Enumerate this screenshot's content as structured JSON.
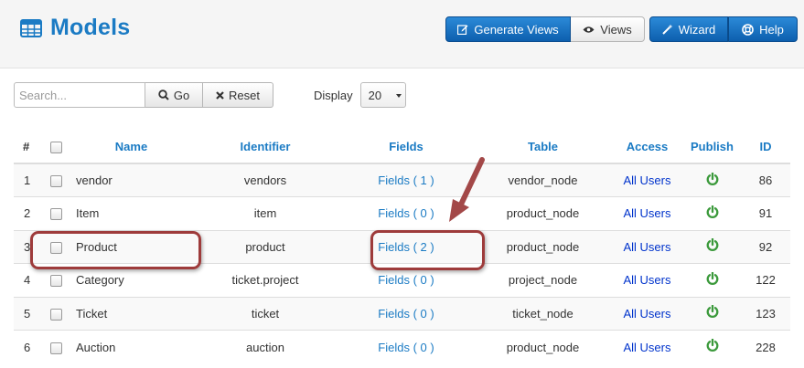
{
  "header": {
    "title": "Models",
    "buttons": {
      "generate_views": "Generate Views",
      "views": "Views",
      "wizard": "Wizard",
      "help": "Help"
    }
  },
  "toolbar": {
    "search_placeholder": "Search...",
    "search_value": "",
    "go_label": "Go",
    "reset_label": "Reset",
    "display_label": "Display",
    "display_value": "20"
  },
  "table": {
    "columns": {
      "num": "#",
      "name": "Name",
      "identifier": "Identifier",
      "fields": "Fields",
      "table": "Table",
      "access": "Access",
      "publish": "Publish",
      "id": "ID"
    },
    "rows": [
      {
        "num": "1",
        "name": "vendor",
        "identifier": "vendors",
        "fields": "Fields ( 1 )",
        "table": "vendor_node",
        "access": "All Users",
        "id": "86"
      },
      {
        "num": "2",
        "name": "Item",
        "identifier": "item",
        "fields": "Fields ( 0 )",
        "table": "product_node",
        "access": "All Users",
        "id": "91"
      },
      {
        "num": "3",
        "name": "Product",
        "identifier": "product",
        "fields": "Fields ( 2 )",
        "table": "product_node",
        "access": "All Users",
        "id": "92"
      },
      {
        "num": "4",
        "name": "Category",
        "identifier": "ticket.project",
        "fields": "Fields ( 0 )",
        "table": "project_node",
        "access": "All Users",
        "id": "122"
      },
      {
        "num": "5",
        "name": "Ticket",
        "identifier": "ticket",
        "fields": "Fields ( 0 )",
        "table": "ticket_node",
        "access": "All Users",
        "id": "123"
      },
      {
        "num": "6",
        "name": "Auction",
        "identifier": "auction",
        "fields": "Fields ( 0 )",
        "table": "product_node",
        "access": "All Users",
        "id": "228"
      }
    ]
  },
  "colors": {
    "accent": "#1b7bc4",
    "publish_on": "#3c9a3c",
    "highlight": "#9e3b3b"
  }
}
